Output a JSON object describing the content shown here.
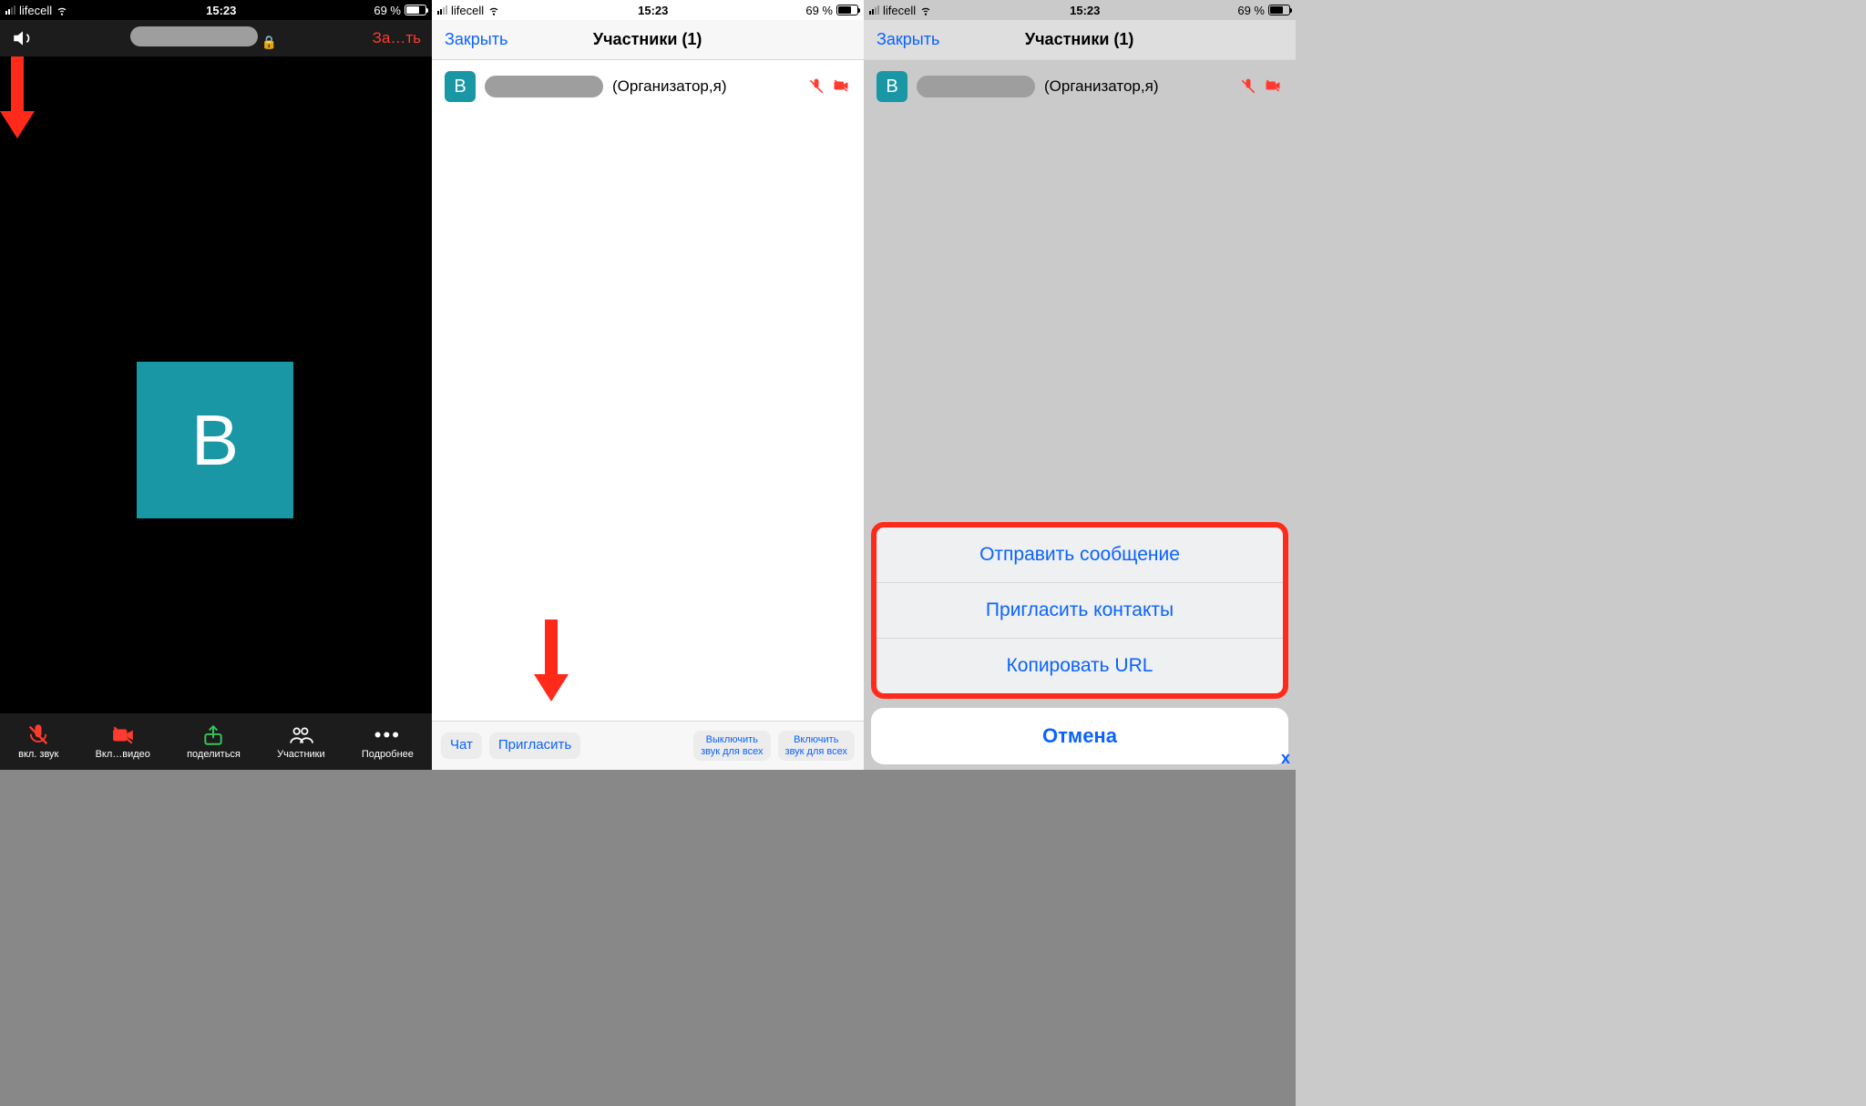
{
  "status": {
    "carrier": "lifecell",
    "time": "15:23",
    "battery_pct": "69 %"
  },
  "screen1": {
    "end_call": "За…ть",
    "avatar_letter": "В",
    "toolbar": {
      "audio": "вкл. звук",
      "video": "Вкл…видео",
      "share": "поделиться",
      "participants": "Участники",
      "more": "Подробнее"
    }
  },
  "screen2": {
    "close": "Закрыть",
    "title": "Участники (1)",
    "participant": {
      "letter": "В",
      "role": "(Организатор,я)"
    },
    "footer": {
      "chat": "Чат",
      "invite": "Пригласить",
      "mute_all": "Выключить\nзвук для всех",
      "unmute_all": "Включить\nзвук для всех"
    }
  },
  "screen3": {
    "close": "Закрыть",
    "title": "Участники (1)",
    "participant": {
      "letter": "В",
      "role": "(Организатор,я)"
    },
    "sheet": {
      "send_message": "Отправить сообщение",
      "invite_contacts": "Пригласить контакты",
      "copy_url": "Копировать URL",
      "cancel": "Отмена"
    }
  }
}
